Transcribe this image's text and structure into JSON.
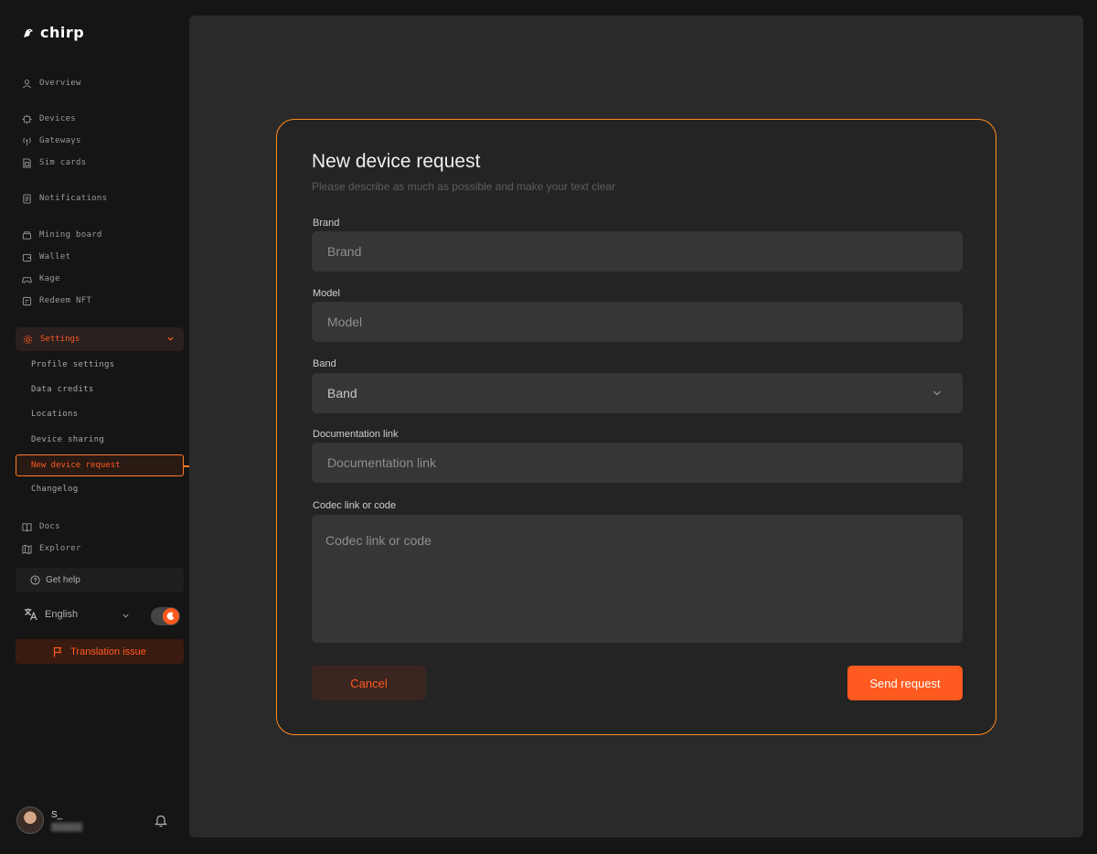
{
  "brand": {
    "name": "chirp"
  },
  "sidebar": {
    "overview": "Overview",
    "devices": "Devices",
    "gateways": "Gateways",
    "sim_cards": "Sim cards",
    "notifications": "Notifications",
    "mining_board": "Mining board",
    "wallet": "Wallet",
    "kage": "Kage",
    "redeem_nft": "Redeem NFT",
    "settings": "Settings",
    "settings_sub": {
      "profile": "Profile settings",
      "data_credits": "Data credits",
      "locations": "Locations",
      "device_sharing": "Device sharing",
      "new_device_request": "New device request",
      "changelog": "Changelog"
    },
    "docs": "Docs",
    "explorer": "Explorer",
    "get_help": "Get help",
    "language": "English",
    "translation_issue": "Translation issue",
    "user_initial": "S_"
  },
  "modal": {
    "title": "New device request",
    "subtitle": "Please describe as much as possible and make your text clear",
    "brand_label": "Brand",
    "brand_placeholder": "Brand",
    "model_label": "Model",
    "model_placeholder": "Model",
    "band_label": "Band",
    "band_value": "Band",
    "doc_label": "Documentation link",
    "doc_placeholder": "Documentation link",
    "codec_label": "Codec link or code",
    "codec_placeholder": "Codec link or code",
    "cancel": "Cancel",
    "send": "Send request"
  },
  "colors": {
    "accent": "#ff5a1f",
    "modal_border": "#ff8c1f",
    "background": "#151515",
    "panel": "#2a2a2a"
  }
}
